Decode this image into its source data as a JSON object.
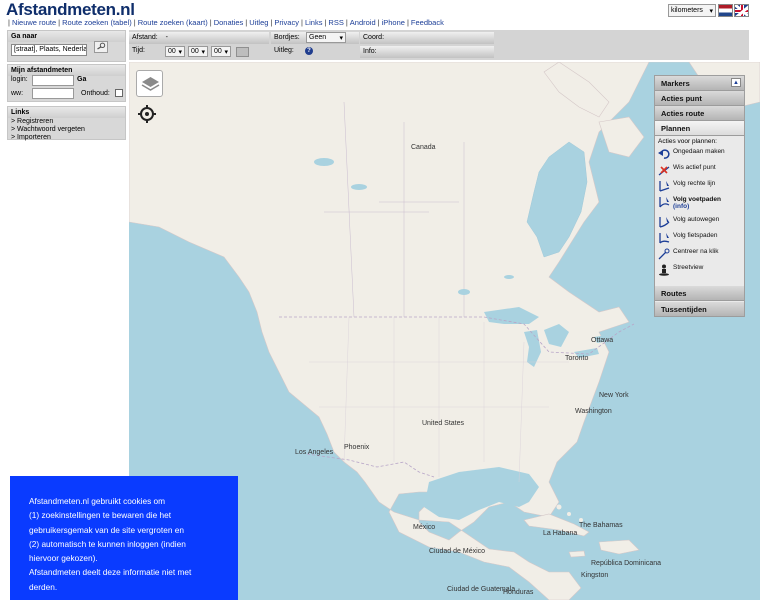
{
  "header": {
    "logo": "Afstandmeten.nl",
    "nav": [
      "Nieuwe route",
      "Route zoeken (tabel)",
      "Route zoeken (kaart)",
      "Donaties",
      "Uitleg",
      "Privacy",
      "Links",
      "RSS",
      "Android",
      "iPhone",
      "Feedback"
    ],
    "units_selected": "kilometers"
  },
  "sidebar": {
    "goto_title": "Ga naar",
    "goto_placeholder": "[straat], Plaats, Nederland",
    "account_title": "Mijn afstandmeten",
    "login_label": "login:",
    "login_button": "Ga",
    "password_label": "ww:",
    "remember_label": "Onthoud:",
    "links_title": "Links",
    "links": [
      "> Registreren",
      "> Wachtwoord vergeten",
      "> Importeren"
    ]
  },
  "infobar": {
    "distance_label": "Afstand:",
    "distance_value": "-",
    "time_label": "Tijd:",
    "time_h": "00",
    "time_m": "00",
    "time_s": "00",
    "signs_label": "Bordjes:",
    "signs_value": "Geen",
    "help_label": "Uitleg:",
    "coord_label": "Coord:",
    "info_label": "Info:"
  },
  "map": {
    "labels": {
      "canada": "Canada",
      "ottawa": "Ottawa",
      "toronto": "Toronto",
      "new_york": "New York",
      "washington": "Washington",
      "united_states": "United States",
      "los_angeles": "Los Angeles",
      "phoenix": "Phoenix",
      "mexico": "México",
      "mexico_city": "Ciudad de México",
      "bahamas": "The Bahamas",
      "havana": "La Habana",
      "kingston": "Kingston",
      "dominicana": "República Dominicana",
      "honduras": "Honduras",
      "guatemala": "Ciudad de Guatemala"
    }
  },
  "panel": {
    "markers": "Markers",
    "acties_punt": "Acties punt",
    "acties_route": "Acties route",
    "plannen": "Plannen",
    "acties_title": "Acties voor plannen:",
    "items": [
      "Ongedaan maken",
      "Wis actief punt",
      "Volg rechte lijn",
      "Volg voetpaden",
      "Volg autowegen",
      "Volg fietspaden",
      "Centreer na klik",
      "Streetview"
    ],
    "info_link": "(info)",
    "routes": "Routes",
    "tussentijden": "Tussentijden"
  },
  "cookie": {
    "lines": [
      "Afstandmeten.nl gebruikt cookies om",
      "(1) zoekinstellingen te bewaren die het",
      "gebruikersgemak van de site vergroten en",
      "(2) automatisch te kunnen inloggen (indien",
      "hiervoor gekozen).",
      "Afstandmeten deelt deze informatie niet met",
      "derden."
    ]
  },
  "colors": {
    "water": "#a9d2e0",
    "land": "#f1eee7",
    "cookie_bg": "#0a3bff",
    "link": "#1c3e97"
  }
}
